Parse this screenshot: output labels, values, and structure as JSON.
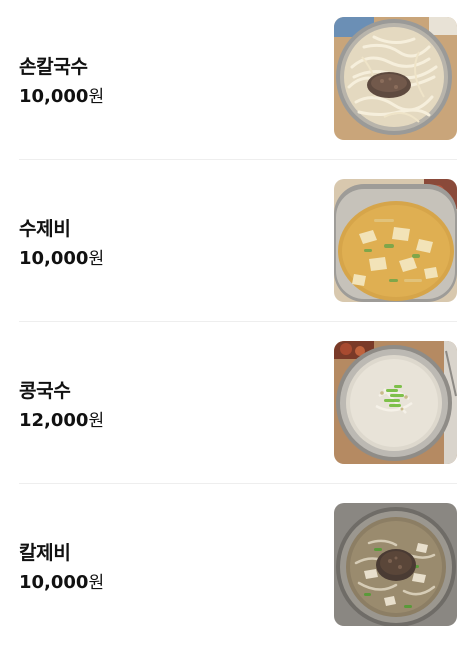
{
  "menu": {
    "items": [
      {
        "name": "손칼국수",
        "price": "10,000",
        "currency": "원",
        "image_icon": "kalguksu-photo"
      },
      {
        "name": "수제비",
        "price": "10,000",
        "currency": "원",
        "image_icon": "sujebi-photo"
      },
      {
        "name": "콩국수",
        "price": "12,000",
        "currency": "원",
        "image_icon": "kongguksu-photo"
      },
      {
        "name": "칼제비",
        "price": "10,000",
        "currency": "원",
        "image_icon": "kaljebi-photo"
      }
    ]
  }
}
